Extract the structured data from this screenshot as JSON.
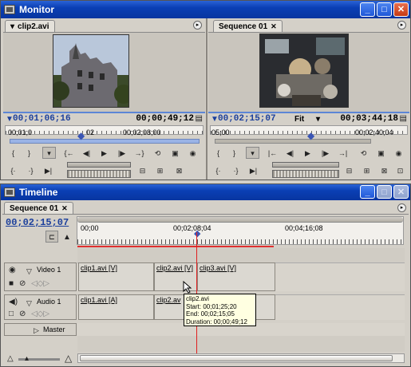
{
  "monitor": {
    "title": "Monitor",
    "source_tab": "clip2.avi",
    "program_tab": "Sequence 01",
    "source_current_tc": "00;01;06;16",
    "source_duration_tc": "00;00;49;12",
    "source_ruler_left": "00;01;0",
    "source_ruler_mark": "02",
    "source_ruler_right": "00;02;08;00",
    "program_current_tc": "00;02;15;07",
    "program_zoom": "Fit",
    "program_duration_tc": "00;03;44;18",
    "program_ruler_left": "05;00",
    "program_ruler_right": "00;02;40;04"
  },
  "timeline": {
    "title": "Timeline",
    "tab": "Sequence 01",
    "current_tc": "00;02;15;07",
    "ruler_start": "00;00",
    "ruler_mid": "00;02;08;04",
    "ruler_end": "00;04;16;08",
    "video_track": "Video 1",
    "audio_track": "Audio 1",
    "master_track": "Master",
    "video_clips": [
      "clip1.avi [V]",
      "clip2.avi [V]",
      "clip3.avi [V]"
    ],
    "audio_clips": [
      "clip1.avi [A]",
      "clip2.av"
    ],
    "tooltip": {
      "name": "clip2.avi",
      "start": "Start: 00;01;25;20",
      "end": "End: 00;02;15;05",
      "duration": "Duration: 00;00;49;12"
    }
  },
  "colors": {
    "titlebar": "#0a3fb4",
    "timecode": "#1b3f9c",
    "playhead": "#e02020",
    "work_area": "#e03030"
  }
}
